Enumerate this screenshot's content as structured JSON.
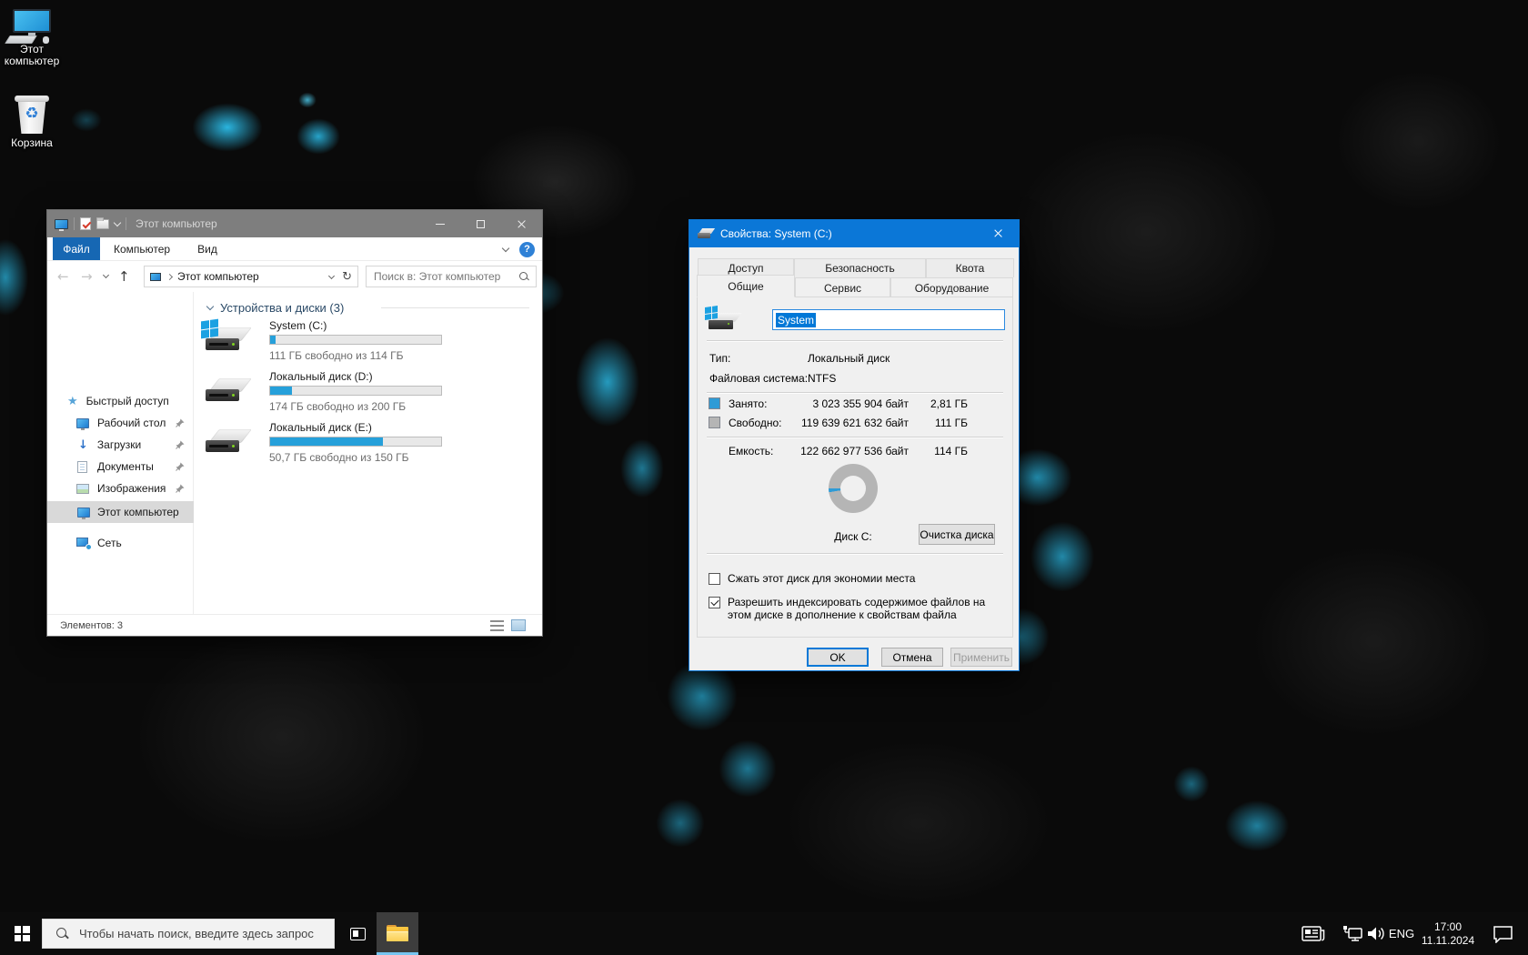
{
  "desktop": {
    "icons": [
      {
        "label": "Этот компьютер"
      },
      {
        "label": "Корзина"
      }
    ]
  },
  "icons": {
    "back": "←",
    "forward": "→",
    "up": "↑",
    "refresh": "↻",
    "star": "★",
    "download": "↓",
    "recycle": "♻",
    "help": "?"
  },
  "explorer": {
    "window_title": "Этот компьютер",
    "menu": {
      "file": "Файл",
      "computer": "Компьютер",
      "view": "Вид"
    },
    "address": "Этот компьютер",
    "search_placeholder": "Поиск в: Этот компьютер",
    "sidebar": {
      "quick_access_label": "Быстрый доступ",
      "items": [
        {
          "label": "Рабочий стол"
        },
        {
          "label": "Загрузки"
        },
        {
          "label": "Документы"
        },
        {
          "label": "Изображения"
        },
        {
          "label": "Этот компьютер"
        },
        {
          "label": "Сеть"
        }
      ]
    },
    "group_header": "Устройства и диски (3)",
    "drives": [
      {
        "name": "System (C:)",
        "free_text": "111 ГБ свободно из 114 ГБ",
        "used_pct": 3
      },
      {
        "name": "Локальный диск (D:)",
        "free_text": "174 ГБ свободно из 200 ГБ",
        "used_pct": 13
      },
      {
        "name": "Локальный диск (E:)",
        "free_text": "50,7 ГБ свободно из 150 ГБ",
        "used_pct": 66
      }
    ],
    "status_text": "Элементов: 3",
    "accent_bar_color": "#26a0da"
  },
  "dialog": {
    "title": "Свойства: System (C:)",
    "tabs_row1": [
      {
        "label": "Доступ"
      },
      {
        "label": "Безопасность"
      },
      {
        "label": "Квота"
      }
    ],
    "tabs_row2": [
      {
        "label": "Общие",
        "active": true
      },
      {
        "label": "Сервис"
      },
      {
        "label": "Оборудование"
      }
    ],
    "volume_name": "System",
    "type_label": "Тип:",
    "type_value": "Локальный диск",
    "fs_label": "Файловая система:",
    "fs_value": "NTFS",
    "used": {
      "label": "Занято:",
      "bytes": "3 023 355 904 байт",
      "size": "2,81 ГБ"
    },
    "free": {
      "label": "Свободно:",
      "bytes": "119 639 621 632 байт",
      "size": "111 ГБ"
    },
    "capacity": {
      "label": "Емкость:",
      "bytes": "122 662 977 536 байт",
      "size": "114 ГБ"
    },
    "donut": {
      "used_deg": 9,
      "used_color": "#2e9bd6",
      "free_color": "#b5b5b5"
    },
    "disk_label": "Диск C:",
    "cleanup_button": "Очистка диска",
    "checkboxes": [
      {
        "label": "Сжать этот диск для экономии места",
        "checked": false
      },
      {
        "label": "Разрешить индексировать содержимое файлов на этом диске в дополнение к свойствам файла",
        "checked": true
      }
    ],
    "ok_button": "OK",
    "cancel_button": "Отмена",
    "apply_button": "Применить",
    "titlebar_color": "#0b77d7"
  },
  "taskbar": {
    "search_placeholder": "Чтобы начать поиск, введите здесь запрос",
    "language": "ENG",
    "time": "17:00",
    "date": "11.11.2024"
  }
}
